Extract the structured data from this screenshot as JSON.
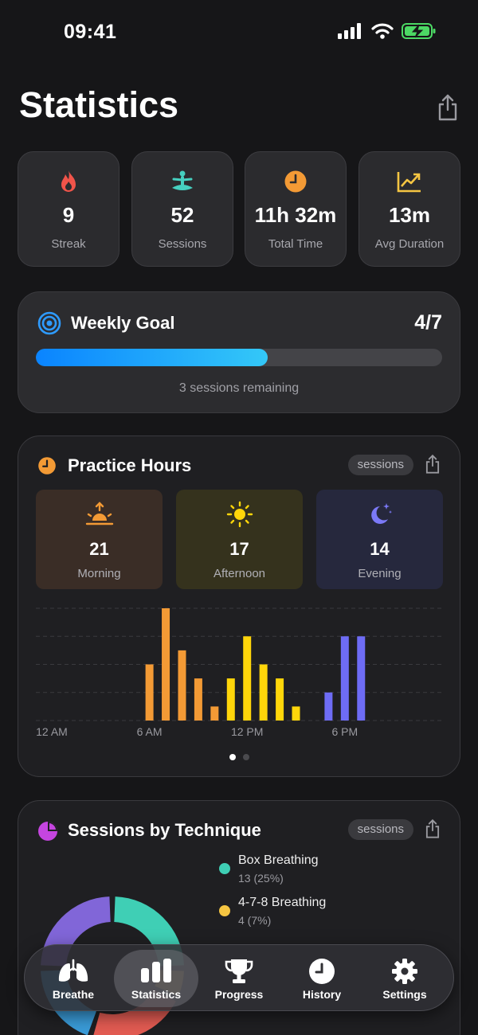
{
  "status": {
    "time": "09:41"
  },
  "header": {
    "title": "Statistics"
  },
  "stats": [
    {
      "value": "9",
      "label": "Streak",
      "icon": "flame-icon"
    },
    {
      "value": "52",
      "label": "Sessions",
      "icon": "meditation-icon"
    },
    {
      "value": "11h 32m",
      "label": "Total Time",
      "icon": "clock-icon"
    },
    {
      "value": "13m",
      "label": "Avg Duration",
      "icon": "trend-chart-icon"
    }
  ],
  "weekly_goal": {
    "title": "Weekly Goal",
    "count": "4/7",
    "progress": 0.57,
    "remaining": "3 sessions remaining"
  },
  "practice_hours": {
    "title": "Practice Hours",
    "pill": "sessions",
    "periods": [
      {
        "value": "21",
        "label": "Morning",
        "color": "#f39a35"
      },
      {
        "value": "17",
        "label": "Afternoon",
        "color": "#ffd60a"
      },
      {
        "value": "14",
        "label": "Evening",
        "color": "#6e6cf5"
      }
    ]
  },
  "chart_data": {
    "type": "bar",
    "x_tick_labels": [
      "12 AM",
      "6 AM",
      "12 PM",
      "6 PM"
    ],
    "series": [
      {
        "name": "Morning",
        "color": "#f39a35",
        "x": [
          6,
          7,
          8,
          9,
          10
        ],
        "values": [
          4,
          8,
          5,
          3,
          1
        ]
      },
      {
        "name": "Afternoon",
        "color": "#ffd60a",
        "x": [
          11,
          12,
          13,
          14,
          15
        ],
        "values": [
          3,
          6,
          4,
          3,
          1
        ]
      },
      {
        "name": "Evening",
        "color": "#6e6cf5",
        "x": [
          17,
          18,
          19
        ],
        "values": [
          2,
          6,
          6
        ]
      }
    ],
    "xlim": [
      0,
      23
    ],
    "ylim": [
      0,
      8
    ],
    "grid": true
  },
  "technique": {
    "title": "Sessions by Technique",
    "pill": "sessions",
    "items": [
      {
        "name": "Box Breathing",
        "value": "13 (25%)",
        "color": "#3fcfb5"
      },
      {
        "name": "4-7-8 Breathing",
        "value": "4 (7%)",
        "color": "#f5c542"
      }
    ],
    "donut_colors": [
      "#3fcfb5",
      "#f5c542",
      "#e25b52",
      "#3a9bd8",
      "#8166d8"
    ],
    "donut_shares": [
      25,
      7,
      23,
      20,
      25
    ]
  },
  "tabs": [
    {
      "label": "Breathe",
      "icon": "lungs-icon"
    },
    {
      "label": "Statistics",
      "icon": "bar-chart-icon",
      "active": true
    },
    {
      "label": "Progress",
      "icon": "trophy-icon"
    },
    {
      "label": "History",
      "icon": "clock-icon"
    },
    {
      "label": "Settings",
      "icon": "gear-icon"
    }
  ]
}
